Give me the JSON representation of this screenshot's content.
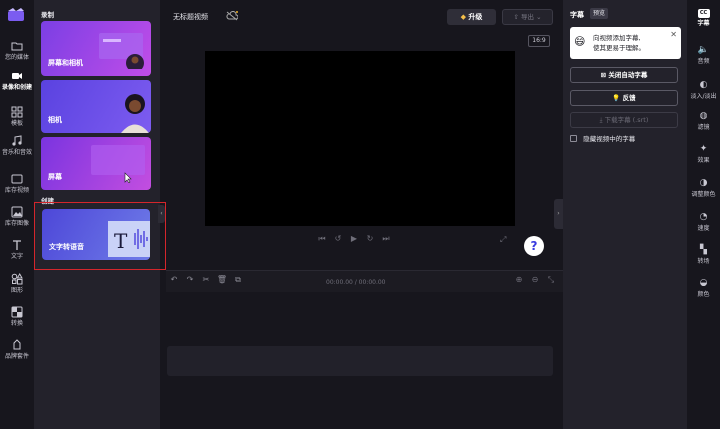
{
  "rail": {
    "items": [
      {
        "label": "您的媒体",
        "icon": "folder-icon"
      },
      {
        "label": "录像和创建",
        "icon": "video-camera-icon"
      },
      {
        "label": "模板",
        "icon": "template-grid-icon"
      },
      {
        "label": "音乐和音效",
        "icon": "music-note-icon"
      },
      {
        "label": "库存视频",
        "icon": "film-icon"
      },
      {
        "label": "库存图像",
        "icon": "image-icon"
      },
      {
        "label": "文字",
        "icon": "text-t-icon"
      },
      {
        "label": "图形",
        "icon": "shapes-icon"
      },
      {
        "label": "转换",
        "icon": "transition-icon"
      },
      {
        "label": "品牌套件",
        "icon": "brand-kit-icon"
      }
    ]
  },
  "library": {
    "record_heading": "录制",
    "create_heading": "创建",
    "cards": [
      {
        "label": "屏幕和相机"
      },
      {
        "label": "相机"
      },
      {
        "label": "屏幕"
      },
      {
        "label": "文字转语音"
      }
    ]
  },
  "main": {
    "project_title": "无标题视频",
    "upgrade_label": "升级",
    "export_label": "导出",
    "aspect_ratio": "16:9",
    "help_label": "?",
    "timecode": "00:00.00 / 00:00.00"
  },
  "captions": {
    "heading": "字幕",
    "badge": "预览",
    "tip_line1": "向视频添加字幕,",
    "tip_line2": "使其更易于理解。",
    "tip_emoji": "😄",
    "btn_auto": "关闭自动字幕",
    "btn_feedback": "反馈",
    "btn_download": "下载字幕 (.srt)",
    "hide_label": "隐藏视频中的字幕"
  },
  "right_rail": {
    "items": [
      {
        "label": "字幕",
        "icon": "cc-icon"
      },
      {
        "label": "音频",
        "icon": "speaker-icon"
      },
      {
        "label": "淡入/淡出",
        "icon": "fade-icon"
      },
      {
        "label": "滤镜",
        "icon": "filter-icon"
      },
      {
        "label": "效果",
        "icon": "magic-wand-icon"
      },
      {
        "label": "调整颜色",
        "icon": "contrast-icon"
      },
      {
        "label": "速度",
        "icon": "speedometer-icon"
      },
      {
        "label": "转场",
        "icon": "transition-icon"
      },
      {
        "label": "颜色",
        "icon": "palette-icon"
      }
    ]
  }
}
